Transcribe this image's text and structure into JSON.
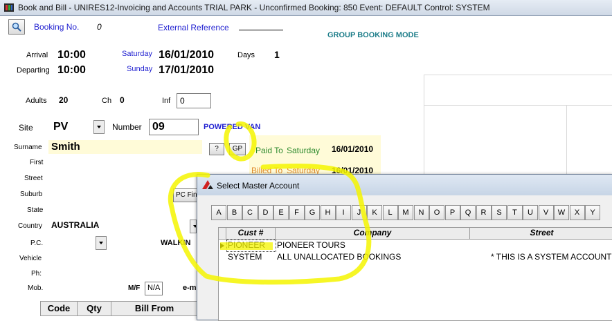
{
  "window": {
    "title": "Book and Bill - UNIRES12-Invoicing and Accounts TRIAL PARK - Unconfirmed Booking: 850 Event: DEFAULT Control: SYSTEM"
  },
  "booking": {
    "label": "Booking No.",
    "number": "0",
    "external_ref_label": "External Reference",
    "mode": "GROUP BOOKING MODE",
    "arrival_label": "Arrival",
    "arrival_time": "10:00",
    "arrival_day": "Saturday",
    "arrival_date": "16/01/2010",
    "days_label": "Days",
    "days": "1",
    "departing_label": "Departing",
    "departing_time": "10:00",
    "departing_day": "Sunday",
    "departing_date": "17/01/2010",
    "adults_label": "Adults",
    "adults": "20",
    "children_label": "Ch",
    "children": "0",
    "infants_label": "Inf",
    "infants": "0"
  },
  "site": {
    "label": "Site",
    "value": "PV",
    "number_label": "Number",
    "number": "09",
    "type": "POWERED VAN"
  },
  "customer": {
    "surname_label": "Surname",
    "surname": "Smith",
    "first_label": "First",
    "street_label": "Street",
    "suburb_label": "Suburb",
    "state_label": "State",
    "country_label": "Country",
    "country": "AUSTRALIA",
    "pc_label": "P.C.",
    "vehicle_label": "Vehicle",
    "ph_label": "Ph:",
    "mob_label": "Mob.",
    "walkin": "WALKIN",
    "mf_label": "M/F",
    "mf_value": "N/A",
    "email_label": "e-m",
    "pc_find": "PC Fin"
  },
  "buttons": {
    "question": "?",
    "gp": "GP"
  },
  "paid": {
    "paid_label": "Paid To",
    "paid_day": "Saturday",
    "paid_date": "16/01/2010",
    "billed_label": "Billed To",
    "billed_day": "Saturday",
    "billed_date": "16/01/2010"
  },
  "items_table": {
    "headers": [
      "Code",
      "Qty",
      "Bill From"
    ]
  },
  "dialog": {
    "title": "Select Master Account",
    "letters": [
      "A",
      "B",
      "C",
      "D",
      "E",
      "F",
      "G",
      "H",
      "I",
      "J",
      "K",
      "L",
      "M",
      "N",
      "O",
      "P",
      "Q",
      "R",
      "S",
      "T",
      "U",
      "V",
      "W",
      "X",
      "Y"
    ],
    "columns": [
      "Cust #",
      "Company",
      "Street"
    ],
    "rows": [
      {
        "cust": "PIONEER",
        "company": "PIONEER TOURS",
        "street": ""
      },
      {
        "cust": "SYSTEM",
        "company": "ALL UNALLOCATED BOOKINGS",
        "street": "* THIS IS A SYSTEM ACCOUNT *"
      }
    ]
  },
  "colors": {
    "highlight": "#f4f400",
    "accent_blue": "#1f1fd0",
    "mode_teal": "#1e7e8a"
  }
}
